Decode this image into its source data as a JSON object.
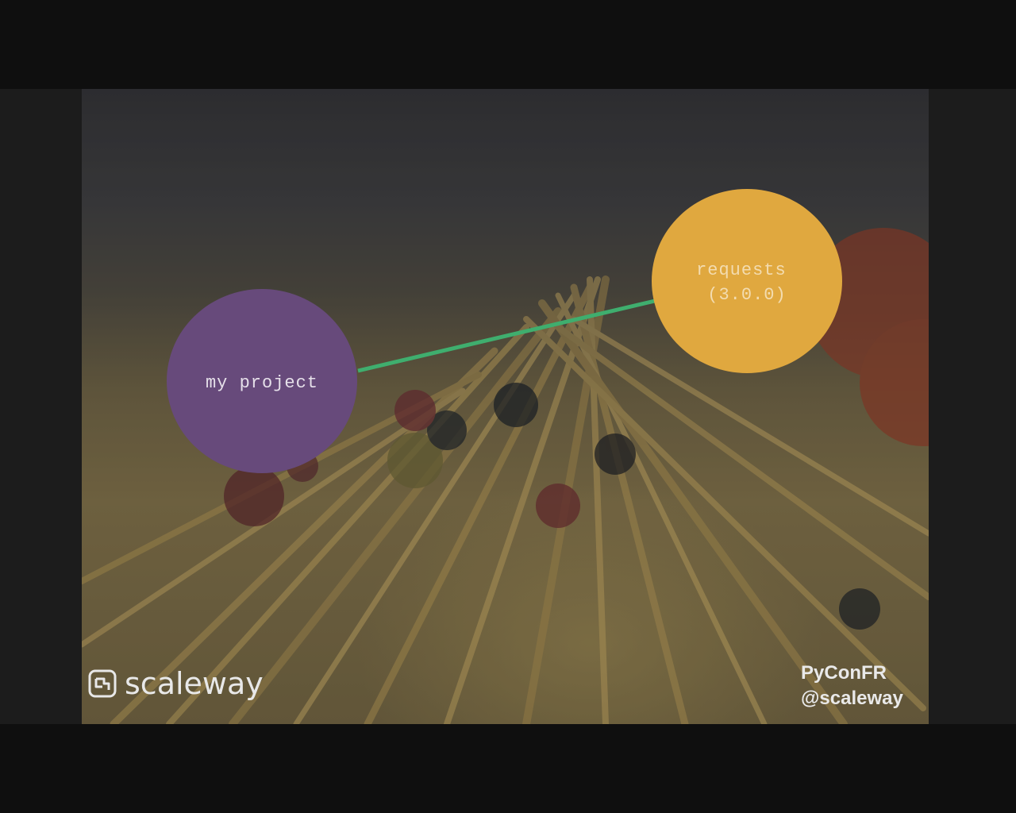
{
  "diagram": {
    "nodes": [
      {
        "id": "my-project",
        "label_lines": [
          "my project"
        ],
        "color": "#674a7b"
      },
      {
        "id": "requests",
        "label_lines": [
          "requests",
          "(3.0.0)"
        ],
        "color": "#e0a83f"
      }
    ],
    "edges": [
      {
        "from": "my-project",
        "to": "requests",
        "color": "#3fae6e"
      }
    ]
  },
  "branding": {
    "logo_text": "scaleway",
    "event_lines": [
      "PyConFR",
      "@scaleway"
    ]
  },
  "colors": {
    "project_node": "#674a7b",
    "requests_node": "#e0a83f",
    "edge": "#3fae6e",
    "node_text_on_purple": "#e6e0ea",
    "node_text_on_orange": "#f3dcb0"
  }
}
